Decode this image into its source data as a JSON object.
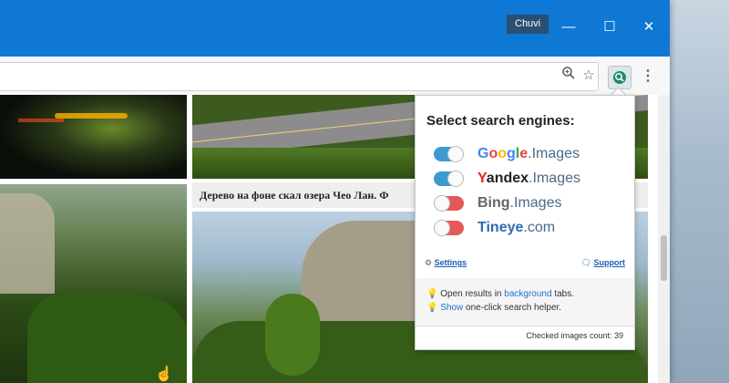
{
  "browser": {
    "profile_name": "Chuvi",
    "window_controls": {
      "minimize": "—",
      "maximize": "☐",
      "close": "✕"
    },
    "accent_color": "#0f78d4",
    "toolbar_icons": [
      "zoom-icon",
      "bookmark-star-icon",
      "search-by-image-extension-icon",
      "menu-kebab-icon"
    ]
  },
  "page": {
    "caption": "Дерево на фоне скал озера Чео Лан. Ф"
  },
  "popup": {
    "title": "Select search engines:",
    "engines": [
      {
        "brand": "Google",
        "suffix": ".Images",
        "enabled": true
      },
      {
        "brand": "Yandex",
        "suffix": ".Images",
        "enabled": true
      },
      {
        "brand": "Bing",
        "suffix": ".Images",
        "enabled": false
      },
      {
        "brand": "Tineye",
        "suffix": ".com",
        "enabled": false
      }
    ],
    "settings_label": "Settings",
    "support_label": "Support",
    "option1": {
      "prefix": "Open results in ",
      "link": "background",
      "suffix": " tabs."
    },
    "option2": {
      "link": "Show",
      "suffix": " one-click search helper."
    },
    "checked_count_label": "Checked images count: 39",
    "toggle_on_color": "#3d9ad1",
    "toggle_off_color": "#e4585a"
  }
}
